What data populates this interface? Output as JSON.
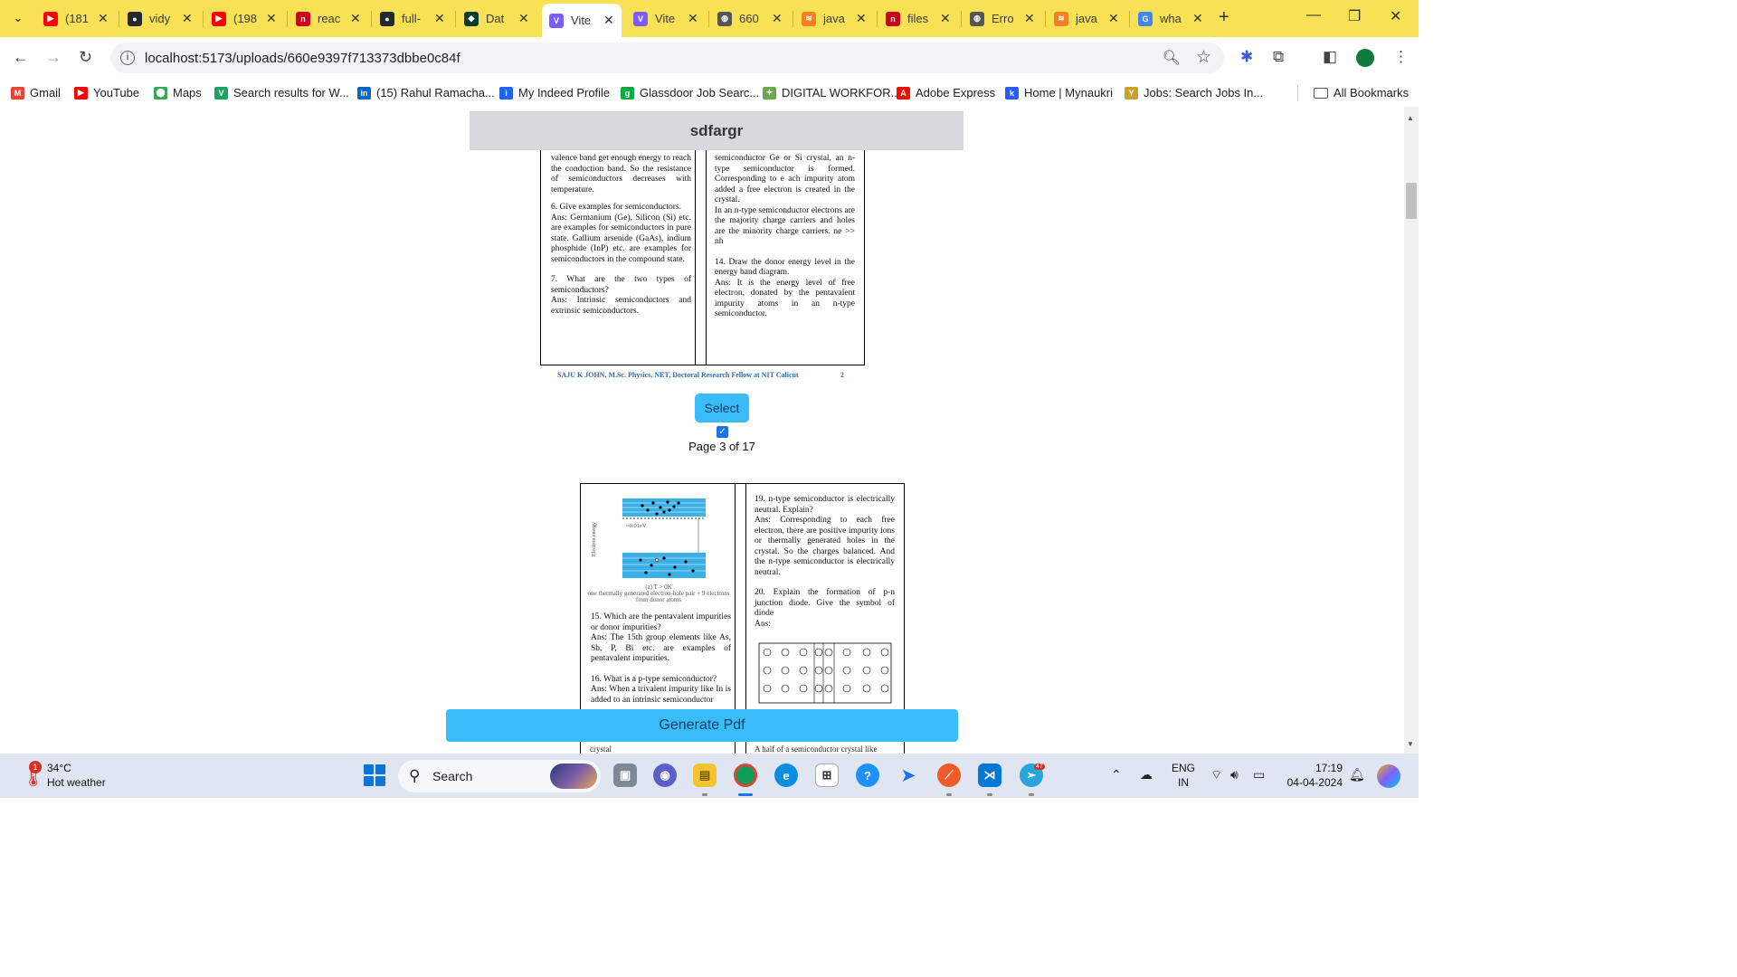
{
  "browser": {
    "tabs": [
      {
        "title": "(181",
        "favicon": "youtube-icon",
        "color": "#ff0000",
        "active": false
      },
      {
        "title": "vidy",
        "favicon": "github-icon",
        "color": "#24292f",
        "active": false
      },
      {
        "title": "(198",
        "favicon": "youtube-icon",
        "color": "#ff0000",
        "active": false
      },
      {
        "title": "reac",
        "favicon": "n-icon",
        "color": "#d0021b",
        "active": false
      },
      {
        "title": "full-",
        "favicon": "github-icon",
        "color": "#24292f",
        "active": false
      },
      {
        "title": "Dat",
        "favicon": "leaf-icon",
        "color": "#0b3d2e",
        "active": false
      },
      {
        "title": "Vite",
        "favicon": "vite-icon",
        "color": "#7b5cff",
        "active": true
      },
      {
        "title": "Vite",
        "favicon": "vite-icon",
        "color": "#7b5cff",
        "active": false
      },
      {
        "title": "660",
        "favicon": "globe-icon",
        "color": "#555555",
        "active": false
      },
      {
        "title": "java",
        "favicon": "stackoverflow-icon",
        "color": "#f48024",
        "active": false
      },
      {
        "title": "files",
        "favicon": "n-icon",
        "color": "#d0021b",
        "active": false
      },
      {
        "title": "Erro",
        "favicon": "globe-icon",
        "color": "#555555",
        "active": false
      },
      {
        "title": "java",
        "favicon": "stackoverflow-icon",
        "color": "#f48024",
        "active": false
      },
      {
        "title": "wha",
        "favicon": "google-icon",
        "color": "#4285f4",
        "active": false
      }
    ],
    "url": "localhost:5173/uploads/660e9397f713373dbbe0c84f",
    "bookmarks": [
      {
        "label": "Gmail",
        "icon": "gmail-icon",
        "color": "#ea4335"
      },
      {
        "label": "YouTube",
        "icon": "youtube-icon",
        "color": "#ff0000"
      },
      {
        "label": "Maps",
        "icon": "maps-icon",
        "color": "#34a853"
      },
      {
        "label": "Search results for W...",
        "icon": "vuetify-icon",
        "color": "#1aa260"
      },
      {
        "label": "(15) Rahul Ramacha...",
        "icon": "linkedin-icon",
        "color": "#0a66c2"
      },
      {
        "label": "My Indeed Profile",
        "icon": "indeed-icon",
        "color": "#2164f3"
      },
      {
        "label": "Glassdoor Job Searc...",
        "icon": "glassdoor-icon",
        "color": "#0caa41"
      },
      {
        "label": "DIGITAL WORKFOR...",
        "icon": "digital-icon",
        "color": "#6aa84f"
      },
      {
        "label": "Adobe Express",
        "icon": "adobe-icon",
        "color": "#eb1000"
      },
      {
        "label": "Home | Mynaukri",
        "icon": "mynaukri-icon",
        "color": "#275df5"
      },
      {
        "label": "Jobs: Search Jobs In...",
        "icon": "jobs-icon",
        "color": "#c9a227"
      }
    ],
    "all_bookmarks": "All Bookmarks"
  },
  "page": {
    "header_title": "sdfargr",
    "page1": {
      "left_col": [
        "valence band get enough energy to reach the conduction band. So the resistance of semiconductors decreases with temperature.",
        "6. Give examples for semiconductors.",
        "Ans: Germanium (Ge), Silicon (Si) etc. are examples for semiconductors in pure state. Gallium arsenide (GaAs), indium phosphide (InP) etc. are examples for semiconductors in the compound state.",
        "7. What are the two types of semiconductors?",
        "Ans: Intrinsic semiconductors and extrinsic semiconductors."
      ],
      "right_col": [
        "semiconductor Ge or Si crystal, an n-type semiconductor is formed. Corresponding to e ach impurity atom added a free electron is created in the crystal.",
        "In an n-type semiconductor electrons are the majority charge carriers and holes are the minority charge carriers. ne >> nh",
        "14. Draw the donor energy level in the energy band diagram.",
        "Ans: It is the energy level of free electron, donated by the pentavalent impurity atoms in an n-type semiconductor."
      ],
      "footer": "SAJU K JOHN, M.Sc. Physics, NET, Doctoral Research Fellow at NIT Calicut",
      "footer_num": "2"
    },
    "select_label": "Select",
    "page_label": "Page 3 of 17",
    "page2": {
      "diagram_caption_1": "(a) T > 0K",
      "diagram_caption_2": "one thermally generated electron-hole pair + 9 electrons from donor atoms",
      "diagram_ev": "≈0.01eV",
      "diagram_axis": "Electron energy",
      "left_col": [
        "15. Which are the pentavalent impurities or donor impurities?",
        "Ans: The 15th group elements like As, Sb, P, Bi etc. are examples of pentavalent impurities.",
        "16. What is a p-type semiconductor?",
        "Ans: When a trivalent impurity like In is added to an intrinsic semiconductor"
      ],
      "right_col": [
        "19. n-type semiconductor is electrically neutral. Explain?",
        "Ans: Corresponding to each free electron, there are positive impurity ions or thermally generated holes in the crystal. So the charges balanced. And the n-type semiconductor is electrically neutral.",
        "20. Explain the formation of p-n junction diode. Give the symbol of diode",
        "Ans:"
      ],
      "cut_left": "crystal",
      "cut_right": "A half of a semiconductor crystal like"
    },
    "generate_label": "Generate Pdf"
  },
  "taskbar": {
    "weather_temp": "34°C",
    "weather_cond": "Hot weather",
    "weather_badge": "1",
    "search_label": "Search",
    "telegram_badge": "47",
    "lang_1": "ENG",
    "lang_2": "IN",
    "time": "17:19",
    "date": "04-04-2024"
  }
}
